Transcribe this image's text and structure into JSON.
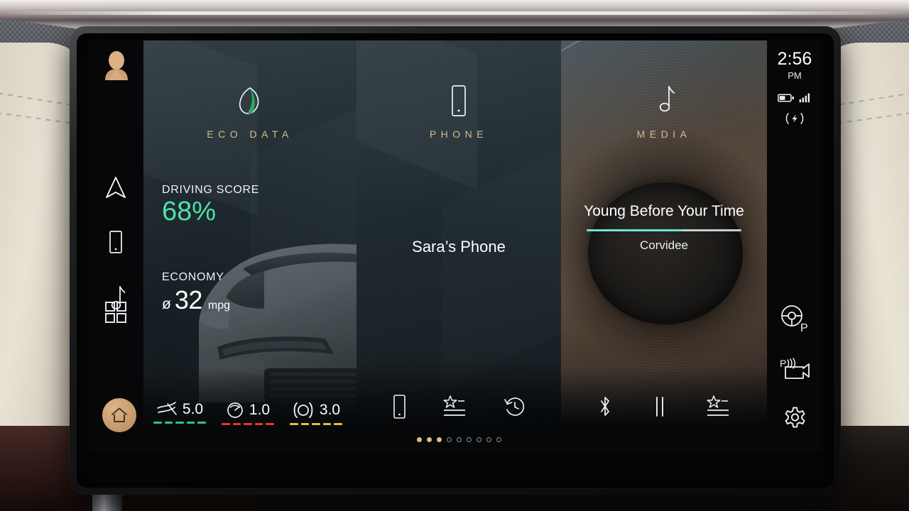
{
  "status_bar": {
    "time": "2:56",
    "meridiem": "PM",
    "battery_icon": "battery-half-icon",
    "signal_icon": "cellular-signal-icon",
    "wireless_charge_icon": "wireless-charging-icon"
  },
  "left_rail": {
    "profile_icon": "user-profile-icon",
    "items": [
      {
        "name": "navigation",
        "icon": "navigation-arrow-icon"
      },
      {
        "name": "phone",
        "icon": "smartphone-icon"
      },
      {
        "name": "media",
        "icon": "music-note-icon"
      }
    ],
    "apps_icon": "apps-grid-icon",
    "home_icon": "home-icon"
  },
  "right_rail": {
    "items": [
      {
        "name": "park-assist",
        "icon": "steering-wheel-park-icon"
      },
      {
        "name": "parking-sensors",
        "icon": "park-sensor-camera-icon"
      },
      {
        "name": "settings",
        "icon": "settings-gear-icon"
      }
    ]
  },
  "panels": {
    "eco": {
      "title": "ECO DATA",
      "icon": "eco-leaf-icon",
      "driving_score_label": "DRIVING SCORE",
      "driving_score_value": "68%",
      "driving_score_color": "#4fe0a8",
      "economy_label": "ECONOMY",
      "economy_avg_symbol": "ø",
      "economy_value": "32",
      "economy_unit": "mpg",
      "metrics": [
        {
          "name": "acceleration",
          "icon": "acceleration-icon",
          "value": "5.0",
          "color": "#2fc18c",
          "segments": 5
        },
        {
          "name": "speed",
          "icon": "speedometer-icon",
          "value": "1.0",
          "color": "#e0392f",
          "segments": 5
        },
        {
          "name": "braking",
          "icon": "brake-icon",
          "value": "3.0",
          "color": "#e0c13a",
          "segments": 5
        }
      ]
    },
    "phone": {
      "title": "PHONE",
      "icon": "smartphone-icon",
      "device_name": "Sara’s Phone",
      "actions": [
        {
          "name": "dial-pad",
          "icon": "smartphone-icon"
        },
        {
          "name": "favourites",
          "icon": "favourites-list-icon"
        },
        {
          "name": "recent-calls",
          "icon": "recent-calls-icon"
        }
      ]
    },
    "media": {
      "title": "MEDIA",
      "icon": "music-note-icon",
      "track_title": "Young Before Your Time",
      "artist": "Corvidee",
      "progress_percent": 62,
      "progress_color": "#6fe3d6",
      "actions": [
        {
          "name": "bluetooth-source",
          "icon": "bluetooth-icon"
        },
        {
          "name": "pause",
          "icon": "pause-icon"
        },
        {
          "name": "favourites",
          "icon": "favourites-list-icon"
        }
      ]
    }
  },
  "pagination": {
    "total": 9,
    "active": 3
  }
}
